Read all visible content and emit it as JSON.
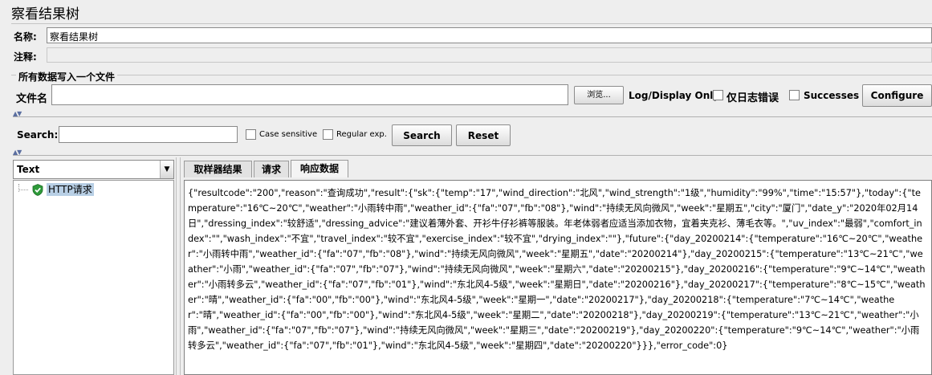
{
  "window": {
    "title": "察看结果树"
  },
  "name_row": {
    "label": "名称:",
    "value": "察看结果树"
  },
  "comment_row": {
    "label": "注释:"
  },
  "file_section": {
    "legend": "所有数据写入一个文件",
    "file_label": "文件名",
    "file_value": "",
    "browse_label": "浏览...",
    "log_display_label": "Log/Display Only:",
    "errors_only_label": "仅日志错误",
    "successes_label": "Successes",
    "configure_label": "Configure"
  },
  "search": {
    "label": "Search:",
    "value": "",
    "case_sensitive_label": "Case sensitive",
    "regex_label": "Regular exp.",
    "search_label": "Search",
    "reset_label": "Reset"
  },
  "renderer": {
    "selected": "Text"
  },
  "tree": {
    "items": [
      {
        "label": "HTTP请求",
        "status": "success"
      }
    ]
  },
  "tabs": [
    {
      "label": "取样器结果",
      "active": false
    },
    {
      "label": "请求",
      "active": false
    },
    {
      "label": "响应数据",
      "active": true
    }
  ],
  "response_text": "{\"resultcode\":\"200\",\"reason\":\"查询成功\",\"result\":{\"sk\":{\"temp\":\"17\",\"wind_direction\":\"北风\",\"wind_strength\":\"1级\",\"humidity\":\"99%\",\"time\":\"15:57\"},\"today\":{\"temperature\":\"16℃~20℃\",\"weather\":\"小雨转中雨\",\"weather_id\":{\"fa\":\"07\",\"fb\":\"08\"},\"wind\":\"持续无风向微风\",\"week\":\"星期五\",\"city\":\"厦门\",\"date_y\":\"2020年02月14日\",\"dressing_index\":\"较舒适\",\"dressing_advice\":\"建议着薄外套、开衫牛仔衫裤等服装。年老体弱者应适当添加衣物，宜着夹克衫、薄毛衣等。\",\"uv_index\":\"最弱\",\"comfort_index\":\"\",\"wash_index\":\"不宜\",\"travel_index\":\"较不宜\",\"exercise_index\":\"较不宜\",\"drying_index\":\"\"},\"future\":{\"day_20200214\":{\"temperature\":\"16℃~20℃\",\"weather\":\"小雨转中雨\",\"weather_id\":{\"fa\":\"07\",\"fb\":\"08\"},\"wind\":\"持续无风向微风\",\"week\":\"星期五\",\"date\":\"20200214\"},\"day_20200215\":{\"temperature\":\"13℃~21℃\",\"weather\":\"小雨\",\"weather_id\":{\"fa\":\"07\",\"fb\":\"07\"},\"wind\":\"持续无风向微风\",\"week\":\"星期六\",\"date\":\"20200215\"},\"day_20200216\":{\"temperature\":\"9℃~14℃\",\"weather\":\"小雨转多云\",\"weather_id\":{\"fa\":\"07\",\"fb\":\"01\"},\"wind\":\"东北风4-5级\",\"week\":\"星期日\",\"date\":\"20200216\"},\"day_20200217\":{\"temperature\":\"8℃~15℃\",\"weather\":\"晴\",\"weather_id\":{\"fa\":\"00\",\"fb\":\"00\"},\"wind\":\"东北风4-5级\",\"week\":\"星期一\",\"date\":\"20200217\"},\"day_20200218\":{\"temperature\":\"7℃~14℃\",\"weather\":\"晴\",\"weather_id\":{\"fa\":\"00\",\"fb\":\"00\"},\"wind\":\"东北风4-5级\",\"week\":\"星期二\",\"date\":\"20200218\"},\"day_20200219\":{\"temperature\":\"13℃~21℃\",\"weather\":\"小雨\",\"weather_id\":{\"fa\":\"07\",\"fb\":\"07\"},\"wind\":\"持续无风向微风\",\"week\":\"星期三\",\"date\":\"20200219\"},\"day_20200220\":{\"temperature\":\"9℃~14℃\",\"weather\":\"小雨转多云\",\"weather_id\":{\"fa\":\"07\",\"fb\":\"01\"},\"wind\":\"东北风4-5级\",\"week\":\"星期四\",\"date\":\"20200220\"}}},\"error_code\":0}",
  "colors": {
    "success_shield": "#2e9a3a",
    "selection": "#b8cfe5",
    "accent": "#5a6ea0"
  },
  "icons": [
    "shield-check-icon",
    "dropdown-arrow-icon",
    "collapse-triangle-icon",
    "tree-line-icon"
  ]
}
